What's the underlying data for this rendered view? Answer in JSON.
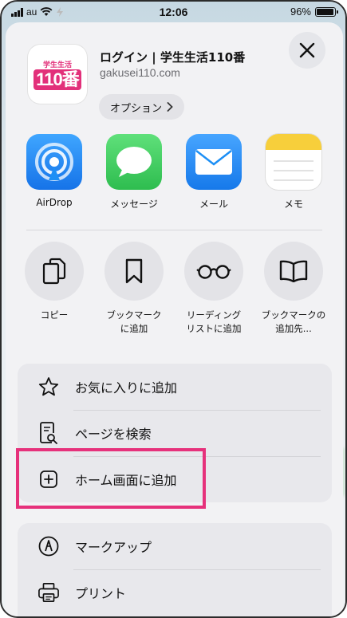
{
  "status_bar": {
    "carrier": "au",
    "time": "12:06",
    "battery_percent": "96%",
    "battery_level": 0.96
  },
  "share_sheet": {
    "app_icon": {
      "line1": "学生生活",
      "line2": "110番"
    },
    "title": "ログイン | 学生生活110番",
    "domain": "gakusei110.com",
    "options_label": "オプション",
    "apps": [
      {
        "label": "AirDrop",
        "icon": "airdrop-icon"
      },
      {
        "label": "メッセージ",
        "icon": "messages-icon"
      },
      {
        "label": "メール",
        "icon": "mail-icon"
      },
      {
        "label": "メモ",
        "icon": "notes-icon"
      }
    ],
    "actions": [
      {
        "label": "コピー",
        "icon": "copy-icon"
      },
      {
        "label": "ブックマーク\nに追加",
        "icon": "bookmark-icon"
      },
      {
        "label": "リーディング\nリストに追加",
        "icon": "glasses-icon"
      },
      {
        "label": "ブックマークの\n追加先...",
        "icon": "book-icon"
      }
    ],
    "list1": [
      {
        "label": "お気に入りに追加",
        "icon": "star-icon"
      },
      {
        "label": "ページを検索",
        "icon": "find-on-page-icon"
      },
      {
        "label": "ホーム画面に追加",
        "icon": "add-square-icon"
      }
    ],
    "list2": [
      {
        "label": "マークアップ",
        "icon": "markup-icon"
      },
      {
        "label": "プリント",
        "icon": "printer-icon"
      }
    ]
  },
  "colors": {
    "highlight": "#e6317b",
    "airdrop_blue": "#1d8ff5",
    "messages_green": "#38c759",
    "notes_yellow": "#f7cf3b"
  }
}
